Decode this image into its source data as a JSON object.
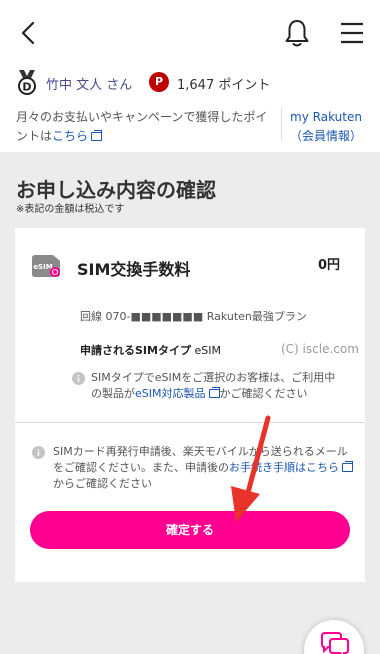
{
  "header": {
    "back_label": "戻る",
    "notification_label": "通知",
    "menu_label": "メニュー"
  },
  "user": {
    "name": "竹中 文人 さん",
    "rank_letter": "D",
    "point_badge": "P",
    "points": "1,647 ポイント"
  },
  "notice": {
    "text_before": "月々のお支払いやキャンペーンで獲得したポイントは",
    "link": "こちら"
  },
  "my_rakuten": {
    "line1": "my Rakuten",
    "line2": "（会員情報）"
  },
  "page": {
    "title": "お申し込み内容の確認",
    "tax_note": "※表記の金額は税込です"
  },
  "card": {
    "icon_label": "eSIM",
    "title": "SIM交換手数料",
    "price": "0円",
    "line_info": "回線 070-■■■■■■■ Rakuten最強プラン",
    "sim_type_label": "申請されるSIMタイプ",
    "sim_type_value": "eSIM",
    "watermark": "(C) iscle.com",
    "sim_note_before": "SIMタイプでeSIMをご選択のお客様は、ご利用中の製品が",
    "sim_note_link": "eSIM対応製品",
    "sim_note_after": "かご確認ください",
    "reissue_before": "SIMカード再発行申請後、楽天モバイルから送られるメールをご確認ください。また、申請後の",
    "reissue_link": "お手続き手順はこちら",
    "reissue_after": "からご確認ください",
    "confirm_label": "確定する"
  },
  "colors": {
    "accent": "#ff0090",
    "brand_red": "#bf0000",
    "link": "#1a56b0"
  }
}
